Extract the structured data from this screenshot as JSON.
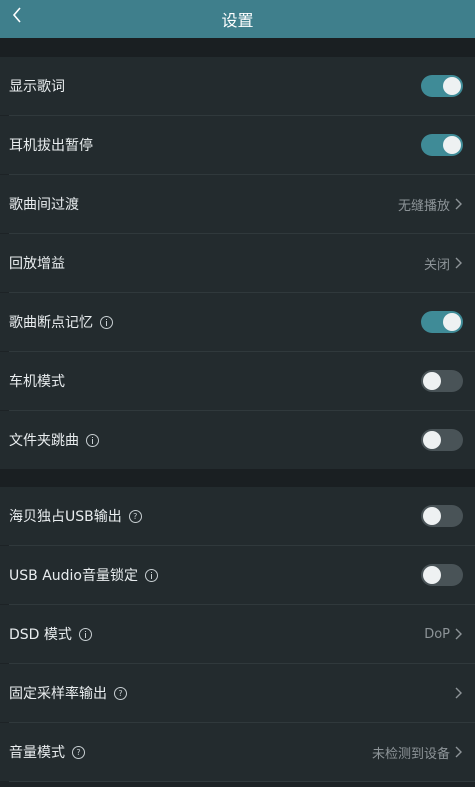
{
  "header": {
    "title": "设置"
  },
  "rows": [
    {
      "label": "显示歌词",
      "toggle_on": true
    },
    {
      "label": "耳机拔出暂停",
      "toggle_on": true
    },
    {
      "label": "歌曲间过渡",
      "value": "无缝播放"
    },
    {
      "label": "回放增益",
      "value": "关闭"
    },
    {
      "label": "歌曲断点记忆",
      "icon": "info-icon",
      "toggle_on": true
    },
    {
      "label": "车机模式",
      "toggle_on": false
    },
    {
      "label": "文件夹跳曲",
      "icon": "info-icon",
      "toggle_on": false
    },
    {
      "label": "海贝独占USB输出",
      "icon": "help-icon",
      "toggle_on": false
    },
    {
      "label": "USB Audio音量锁定",
      "icon": "info-icon",
      "toggle_on": false
    },
    {
      "label": "DSD 模式",
      "icon": "info-icon",
      "value": "DoP"
    },
    {
      "label": "固定采样率输出",
      "icon": "help-icon",
      "value": ""
    },
    {
      "label": "音量模式",
      "icon": "help-icon",
      "value": "未检测到设备"
    }
  ],
  "help_glyph": "?",
  "colors": {
    "header": "#3f7f8c",
    "accent": "#3f8b97",
    "row": "#232b2e",
    "background": "#1d2326"
  }
}
